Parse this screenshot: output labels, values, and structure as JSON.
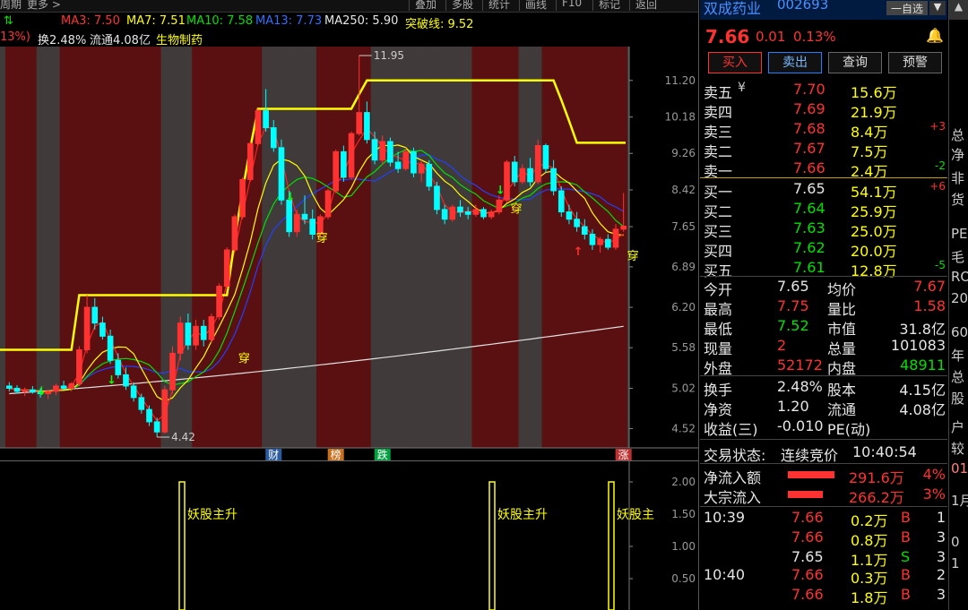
{
  "topbar": {
    "left_items": [
      "周期",
      "更多 >"
    ],
    "buttons": [
      "叠加",
      "多股",
      "统计",
      "画线",
      "F10",
      "标记",
      "返回"
    ]
  },
  "ma": {
    "ma3": "MA3: 7.50",
    "ma7": "MA7: 7.51",
    "ma10": "MA10: 7.58",
    "ma13": "MA13: 7.73",
    "ma250": "MA250: 5.90",
    "breakout": "突破线: 9.52"
  },
  "info": {
    "pct": "13%)",
    "turnover": "换2.48%",
    "float": "流通4.08亿",
    "sector": "生物制药"
  },
  "colors": {
    "up": "#ff3232",
    "down": "#00ffff",
    "ma3": "#ff2020",
    "ma7": "#ffff00",
    "ma10": "#00e000",
    "ma13": "#2040ff",
    "ma250": "#e0e0e0",
    "breakout": "#ffff00",
    "band": "#5a1010",
    "gap": "#403a3a"
  },
  "axis": {
    "price_labels": [
      "11.20",
      "10.18",
      "9.26",
      "8.42",
      "7.65",
      "6.89",
      "6.20",
      "5.58",
      "5.02",
      "4.52"
    ],
    "lower_labels": [
      "2.00",
      "1.50",
      "1.00",
      "0.50"
    ]
  },
  "annotations": {
    "high": "11.95",
    "low": "4.42",
    "cross_label": "穿",
    "events": [
      "财",
      "榜",
      "跌",
      "涨"
    ],
    "signals": [
      "妖股主升",
      "妖股主升",
      "妖股主"
    ]
  },
  "stock": {
    "name": "双成药业",
    "code": "002693",
    "price": "7.66",
    "change": "0.01",
    "change_pct": "0.13%",
    "watch_btn": "一自选"
  },
  "buttons": {
    "buy": "买入",
    "sell": "卖出",
    "query": "查询",
    "alert": "预警"
  },
  "asks": [
    {
      "label": "卖五",
      "price": "7.70",
      "vol": "15.6万",
      "delta": ""
    },
    {
      "label": "卖四",
      "price": "7.69",
      "vol": "21.9万",
      "delta": ""
    },
    {
      "label": "卖三",
      "price": "7.68",
      "vol": "8.4万",
      "delta": "+3"
    },
    {
      "label": "卖二",
      "price": "7.67",
      "vol": "7.5万",
      "delta": ""
    },
    {
      "label": "卖一",
      "price": "7.66",
      "vol": "2.4万",
      "delta": "-2"
    }
  ],
  "bids": [
    {
      "label": "买一",
      "price": "7.65",
      "vol": "54.1万",
      "delta": "+6"
    },
    {
      "label": "买二",
      "price": "7.64",
      "vol": "25.9万",
      "delta": ""
    },
    {
      "label": "买三",
      "price": "7.63",
      "vol": "25.0万",
      "delta": ""
    },
    {
      "label": "买四",
      "price": "7.62",
      "vol": "20.0万",
      "delta": ""
    },
    {
      "label": "买五",
      "price": "7.61",
      "vol": "12.8万",
      "delta": "-5"
    }
  ],
  "stats": [
    {
      "l1": "今开",
      "v1": "7.65",
      "l2": "均价",
      "v2": "7.67"
    },
    {
      "l1": "最高",
      "v1": "7.75",
      "l2": "量比",
      "v2": "1.58"
    },
    {
      "l1": "最低",
      "v1": "7.52",
      "l2": "市值",
      "v2": "31.8亿"
    },
    {
      "l1": "现量",
      "v1": "2",
      "l2": "总量",
      "v2": "101083"
    },
    {
      "l1": "外盘",
      "v1": "52172",
      "l2": "内盘",
      "v2": "48911"
    }
  ],
  "stats2": [
    {
      "l1": "换手",
      "v1": "2.48%",
      "l2": "股本",
      "v2": "4.15亿"
    },
    {
      "l1": "净资",
      "v1": "1.20",
      "l2": "流通",
      "v2": "4.08亿"
    },
    {
      "l1": "收益(三)",
      "v1": "-0.010",
      "l2": "PE(动)",
      "v2": ""
    }
  ],
  "trade_state": {
    "label": "交易状态:",
    "value": "连续竞价",
    "time": "10:40:54"
  },
  "flows": [
    {
      "label": "净流入额",
      "value": "291.6万",
      "pct": "4%",
      "share": 0.4
    },
    {
      "label": "大宗流入",
      "value": "266.2万",
      "pct": "3%",
      "share": 0.3
    }
  ],
  "ticks": [
    {
      "time": "10:39",
      "price": "7.66",
      "vol": "0.2万",
      "side": "B",
      "n": "1"
    },
    {
      "time": "",
      "price": "7.66",
      "vol": "0.8万",
      "side": "B",
      "n": "3"
    },
    {
      "time": "",
      "price": "7.65",
      "vol": "1.1万",
      "side": "S",
      "n": "3"
    },
    {
      "time": "10:40",
      "price": "7.66",
      "vol": "0.3万",
      "side": "B",
      "n": "2"
    },
    {
      "time": "",
      "price": "7.66",
      "vol": "1.8万",
      "side": "B",
      "n": "3"
    }
  ],
  "rightmost": [
    "总",
    "净",
    "非",
    "货",
    "PE",
    "毛",
    "RO",
    "20",
    "60",
    "年",
    "总",
    "股",
    "户",
    "较",
    "01",
    "1月",
    "0",
    "1"
  ],
  "candles": [
    [
      5.05,
      5.1,
      4.98,
      5.02
    ],
    [
      5.02,
      5.06,
      4.95,
      4.98
    ],
    [
      4.98,
      5.03,
      4.92,
      5.0
    ],
    [
      5.0,
      5.05,
      4.95,
      4.97
    ],
    [
      4.97,
      5.02,
      4.9,
      4.95
    ],
    [
      4.95,
      5.0,
      4.88,
      4.98
    ],
    [
      4.98,
      5.08,
      4.93,
      5.05
    ],
    [
      5.05,
      5.12,
      5.0,
      5.02
    ],
    [
      5.02,
      5.1,
      4.98,
      5.08
    ],
    [
      5.08,
      5.6,
      5.05,
      5.55
    ],
    [
      5.55,
      6.4,
      5.5,
      6.2
    ],
    [
      6.2,
      6.35,
      5.85,
      5.95
    ],
    [
      5.95,
      6.05,
      5.7,
      5.75
    ],
    [
      5.75,
      5.85,
      5.35,
      5.4
    ],
    [
      5.4,
      5.5,
      5.15,
      5.2
    ],
    [
      5.2,
      5.3,
      5.0,
      5.05
    ],
    [
      5.05,
      5.1,
      4.85,
      4.9
    ],
    [
      4.9,
      4.95,
      4.7,
      4.75
    ],
    [
      4.75,
      4.8,
      4.55,
      4.6
    ],
    [
      4.6,
      4.65,
      4.42,
      4.48
    ],
    [
      4.48,
      5.05,
      4.46,
      5.0
    ],
    [
      5.0,
      5.6,
      4.95,
      5.5
    ],
    [
      5.5,
      6.05,
      5.4,
      5.95
    ],
    [
      5.95,
      6.1,
      5.55,
      5.62
    ],
    [
      5.62,
      6.0,
      5.55,
      5.9
    ],
    [
      5.9,
      6.0,
      5.6,
      5.7
    ],
    [
      5.7,
      6.1,
      5.65,
      6.05
    ],
    [
      6.05,
      6.6,
      6.0,
      6.55
    ],
    [
      6.55,
      7.25,
      6.5,
      7.2
    ],
    [
      7.2,
      7.9,
      7.15,
      7.85
    ],
    [
      7.85,
      8.7,
      7.8,
      8.65
    ],
    [
      8.65,
      9.55,
      8.6,
      9.5
    ],
    [
      9.5,
      10.4,
      9.45,
      10.35
    ],
    [
      10.35,
      10.95,
      9.8,
      9.9
    ],
    [
      9.9,
      10.1,
      9.3,
      9.4
    ],
    [
      9.4,
      9.6,
      8.1,
      8.2
    ],
    [
      8.2,
      8.4,
      7.45,
      7.55
    ],
    [
      7.55,
      8.0,
      7.45,
      7.9
    ],
    [
      7.9,
      8.3,
      7.7,
      7.8
    ],
    [
      7.8,
      8.0,
      7.4,
      7.5
    ],
    [
      7.5,
      7.9,
      7.45,
      7.85
    ],
    [
      7.85,
      8.45,
      7.8,
      8.4
    ],
    [
      8.4,
      9.35,
      8.35,
      9.3
    ],
    [
      9.3,
      9.45,
      8.6,
      8.7
    ],
    [
      8.7,
      9.8,
      8.65,
      9.75
    ],
    [
      9.75,
      11.95,
      9.7,
      10.3
    ],
    [
      10.3,
      10.6,
      9.5,
      9.6
    ],
    [
      9.6,
      9.8,
      9.0,
      9.1
    ],
    [
      9.1,
      9.7,
      9.0,
      9.55
    ],
    [
      9.55,
      9.65,
      8.95,
      9.05
    ],
    [
      9.05,
      9.3,
      8.8,
      8.9
    ],
    [
      8.9,
      9.4,
      8.85,
      9.3
    ],
    [
      9.3,
      9.4,
      8.7,
      8.8
    ],
    [
      8.8,
      9.1,
      8.6,
      9.0
    ],
    [
      9.0,
      9.1,
      8.4,
      8.5
    ],
    [
      8.5,
      8.6,
      7.9,
      8.0
    ],
    [
      8.0,
      8.1,
      7.7,
      7.8
    ],
    [
      7.8,
      8.1,
      7.75,
      8.05
    ],
    [
      8.05,
      8.2,
      7.85,
      7.95
    ],
    [
      7.95,
      8.05,
      7.8,
      7.9
    ],
    [
      7.9,
      8.1,
      7.85,
      8.0
    ],
    [
      8.0,
      8.05,
      7.8,
      7.85
    ],
    [
      7.85,
      8.0,
      7.8,
      7.95
    ],
    [
      7.95,
      8.3,
      7.9,
      8.2
    ],
    [
      8.2,
      9.1,
      8.15,
      9.05
    ],
    [
      9.05,
      9.2,
      8.5,
      8.6
    ],
    [
      8.6,
      9.0,
      8.55,
      8.9
    ],
    [
      8.9,
      9.15,
      8.5,
      8.6
    ],
    [
      8.6,
      9.6,
      8.55,
      9.45
    ],
    [
      9.45,
      9.5,
      8.8,
      8.9
    ],
    [
      8.9,
      9.1,
      8.3,
      8.4
    ],
    [
      8.4,
      8.5,
      7.85,
      7.95
    ],
    [
      7.95,
      8.1,
      7.7,
      7.8
    ],
    [
      7.8,
      7.95,
      7.55,
      7.65
    ],
    [
      7.65,
      7.8,
      7.4,
      7.5
    ],
    [
      7.5,
      7.6,
      7.2,
      7.3
    ],
    [
      7.3,
      7.45,
      7.15,
      7.4
    ],
    [
      7.4,
      7.5,
      7.2,
      7.25
    ],
    [
      7.25,
      7.7,
      7.2,
      7.6
    ],
    [
      7.6,
      8.35,
      7.55,
      7.66
    ]
  ],
  "bands": [
    [
      0,
      3
    ],
    [
      7,
      19
    ],
    [
      24,
      32
    ],
    [
      40,
      46
    ],
    [
      60,
      65
    ],
    [
      69,
      79
    ]
  ],
  "lower_signals": [
    [
      39
    ],
    [
      65
    ],
    [
      76
    ]
  ]
}
